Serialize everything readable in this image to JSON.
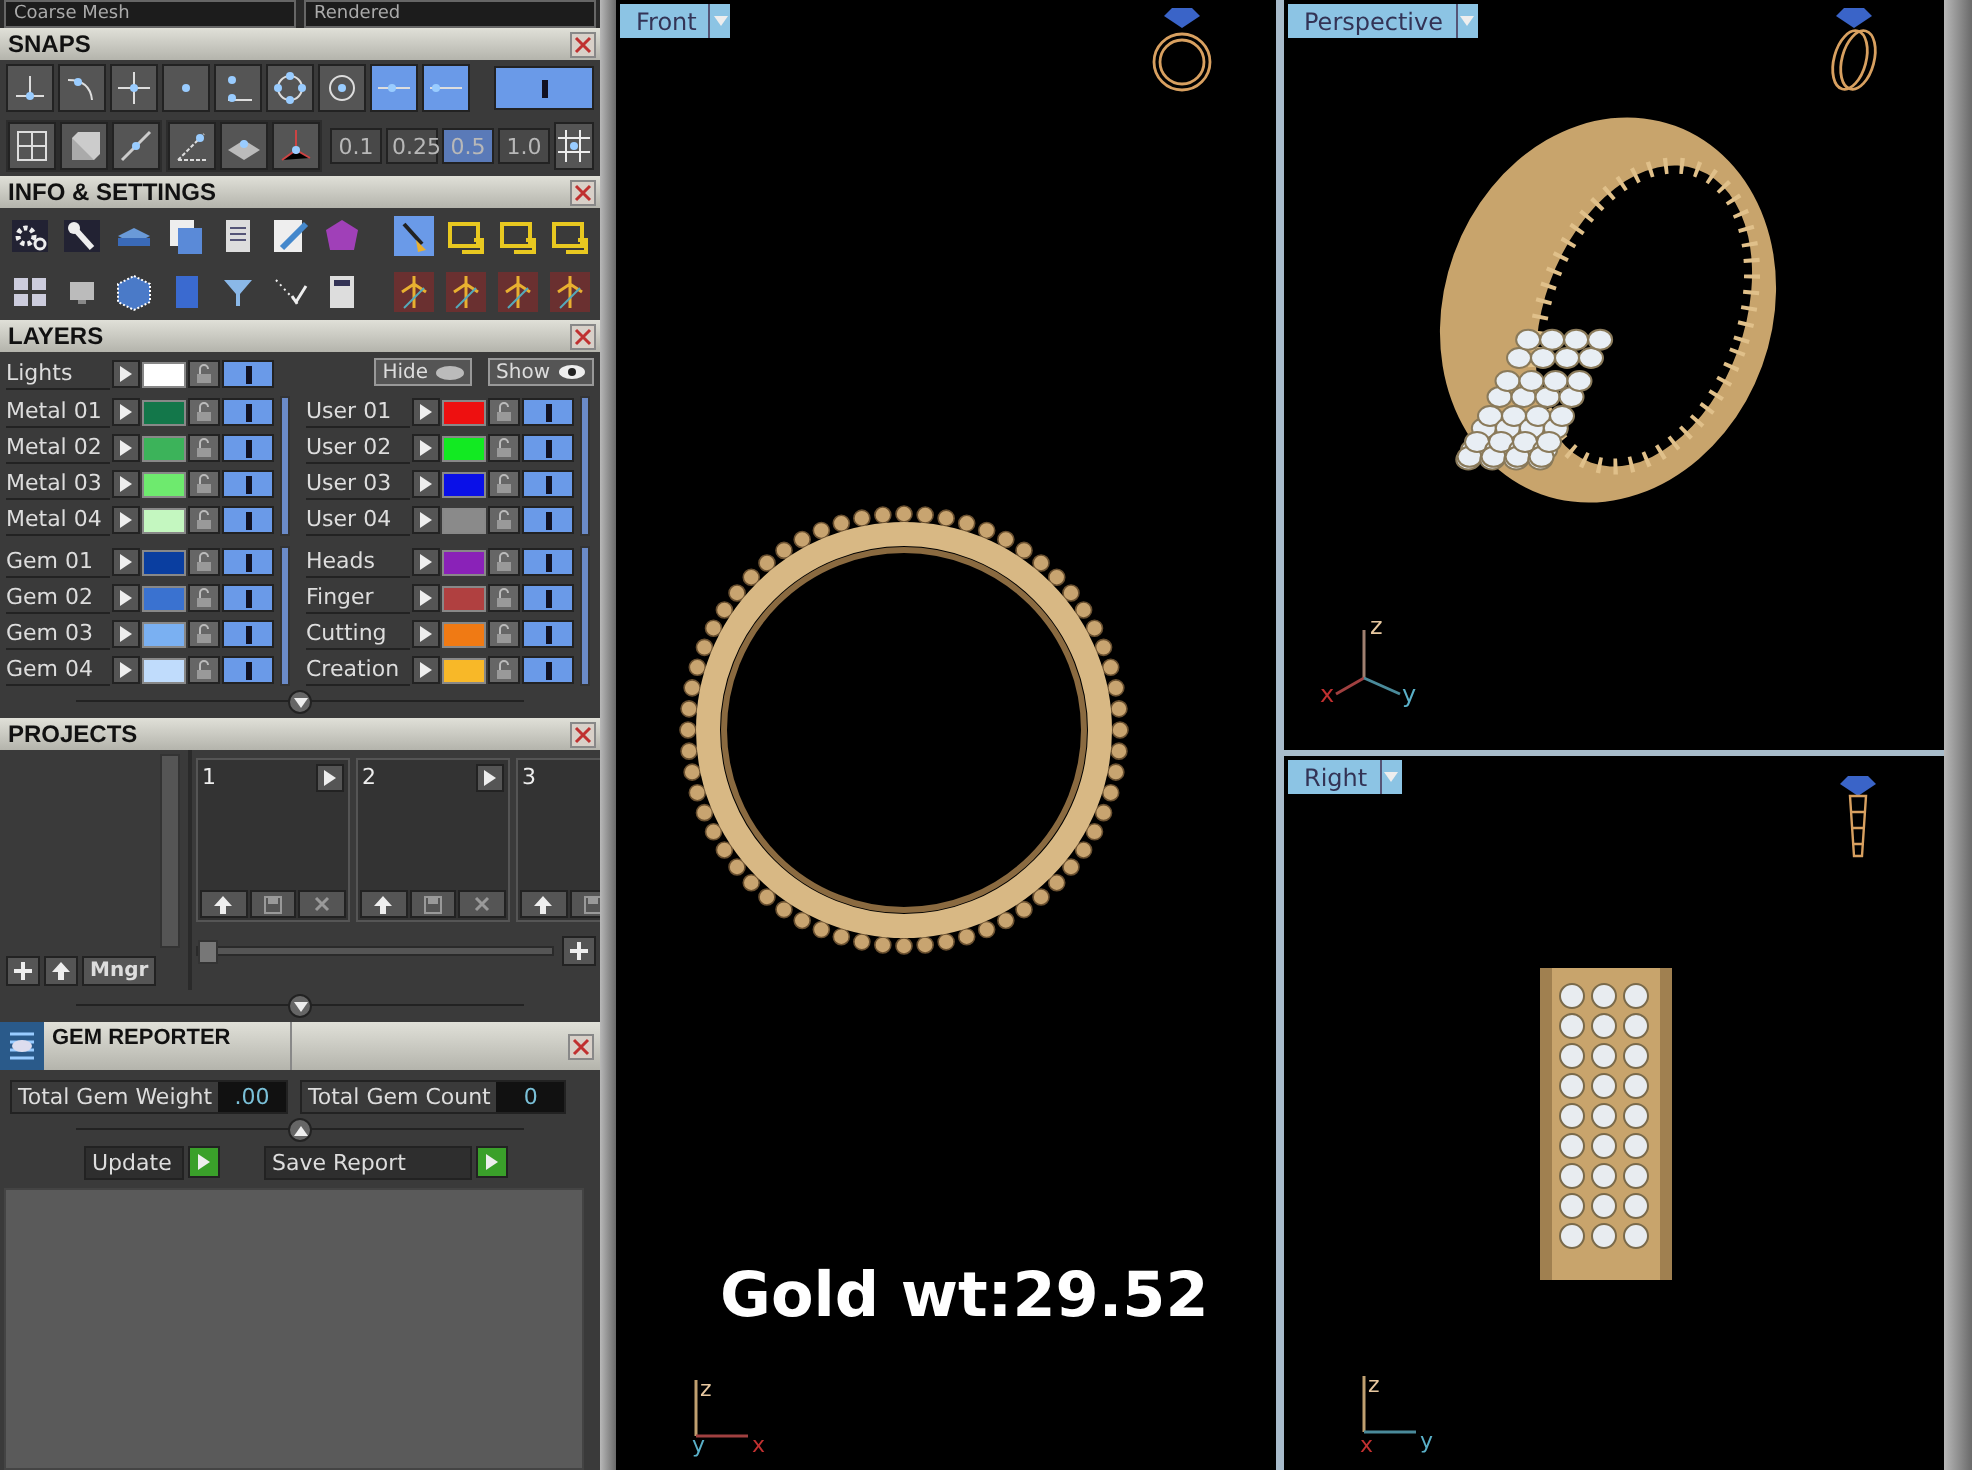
{
  "top_dropdowns": [
    "Coarse Mesh",
    "Rendered"
  ],
  "snaps": {
    "title": "SNAPS",
    "buttons": [
      {
        "selected": false
      },
      {
        "selected": false
      },
      {
        "selected": false
      },
      {
        "selected": false
      },
      {
        "selected": false
      },
      {
        "selected": false
      },
      {
        "selected": false
      },
      {
        "selected": true
      },
      {
        "selected": true
      }
    ],
    "toggle_on": true,
    "tools": [
      {
        "selected": false
      },
      {
        "selected": false
      },
      {
        "selected": false
      },
      {
        "selected": false
      },
      {
        "selected": false
      },
      {
        "selected": false
      }
    ],
    "increments": [
      {
        "label": "0.1",
        "selected": false
      },
      {
        "label": "0.25",
        "selected": false
      },
      {
        "label": "0.5",
        "selected": true
      },
      {
        "label": "1.0",
        "selected": false
      }
    ]
  },
  "info_settings": {
    "title": "INFO & SETTINGS"
  },
  "layers": {
    "title": "LAYERS",
    "lights": {
      "name": "Lights",
      "color": "#ffffff"
    },
    "hide": "Hide",
    "show": "Show",
    "left_groups": [
      [
        {
          "name": "Metal 01",
          "color": "#13774a"
        },
        {
          "name": "Metal 02",
          "color": "#3cb35a"
        },
        {
          "name": "Metal 03",
          "color": "#6eea6e"
        },
        {
          "name": "Metal 04",
          "color": "#c4f7c0"
        }
      ],
      [
        {
          "name": "Gem 01",
          "color": "#0a3ea0"
        },
        {
          "name": "Gem 02",
          "color": "#3a72d0"
        },
        {
          "name": "Gem 03",
          "color": "#7ab0f2"
        },
        {
          "name": "Gem 04",
          "color": "#c0dcfc"
        }
      ]
    ],
    "right_groups": [
      [
        {
          "name": "User 01",
          "color": "#ee1010"
        },
        {
          "name": "User 02",
          "color": "#12ea22"
        },
        {
          "name": "User 03",
          "color": "#0a10e8"
        },
        {
          "name": "User 04",
          "color": "#8a8a8a"
        }
      ],
      [
        {
          "name": "Heads",
          "color": "#8a22b8"
        },
        {
          "name": "Finger",
          "color": "#b04040"
        },
        {
          "name": "Cutting",
          "color": "#f07a14"
        },
        {
          "name": "Creation",
          "color": "#f8b828"
        }
      ]
    ]
  },
  "projects": {
    "title": "PROJECTS",
    "manager_button": "Mngr",
    "slots": [
      "1",
      "2",
      "3"
    ]
  },
  "gem_reporter": {
    "title": "GEM REPORTER",
    "fields": [
      {
        "label": "Total Gem Weight",
        "value": ".00"
      },
      {
        "label": "Total Gem Count",
        "value": "0"
      }
    ],
    "actions": [
      "Update",
      "Save Report"
    ]
  },
  "viewports": [
    {
      "label": "Front",
      "axes": [
        "z",
        "y",
        "x"
      ],
      "overlay": "Gold wt:29.52"
    },
    {
      "label": "Perspective",
      "axes": [
        "z",
        "x",
        "y"
      ]
    },
    {
      "label": "Right",
      "axes": [
        "z",
        "x",
        "y"
      ]
    }
  ]
}
